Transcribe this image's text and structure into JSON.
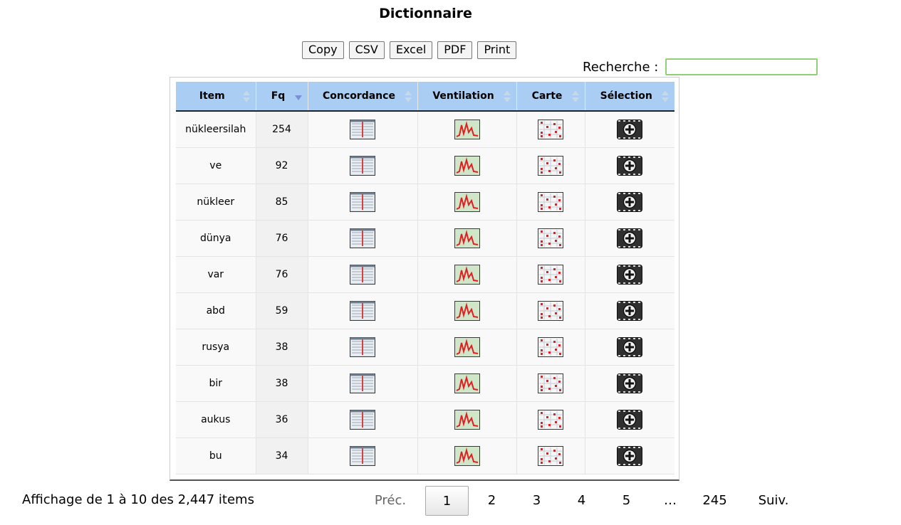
{
  "title": "Dictionnaire",
  "toolbar": {
    "copy": "Copy",
    "csv": "CSV",
    "excel": "Excel",
    "pdf": "PDF",
    "print": "Print"
  },
  "search": {
    "label": "Recherche :",
    "value": "",
    "placeholder": ""
  },
  "columns": [
    "Item",
    "Fq",
    "Concordance",
    "Ventilation",
    "Carte",
    "Sélection"
  ],
  "sorted_column": "Fq",
  "sort_direction": "descending",
  "rows": [
    {
      "item": "nükleersilah",
      "fq": "254"
    },
    {
      "item": "ve",
      "fq": "92"
    },
    {
      "item": "nükleer",
      "fq": "85"
    },
    {
      "item": "dünya",
      "fq": "76"
    },
    {
      "item": "var",
      "fq": "76"
    },
    {
      "item": "abd",
      "fq": "59"
    },
    {
      "item": "rusya",
      "fq": "38"
    },
    {
      "item": "bir",
      "fq": "38"
    },
    {
      "item": "aukus",
      "fq": "36"
    },
    {
      "item": "bu",
      "fq": "34"
    }
  ],
  "row_icons": [
    "concordance-icon",
    "ventilation-chart-icon",
    "map-grid-icon",
    "add-selection-icon"
  ],
  "footer": {
    "info": "Affichage de 1 à 10 des 2,447 items"
  },
  "pagination": {
    "prev": "Préc.",
    "pages": [
      "1",
      "2",
      "3",
      "4",
      "5"
    ],
    "current": "1",
    "ellipsis": "…",
    "last": "245",
    "next": "Suiv."
  },
  "colors": {
    "header": "#a9cdf3",
    "search_border": "#8fcf77",
    "sort_active": "#7b8fd6"
  }
}
